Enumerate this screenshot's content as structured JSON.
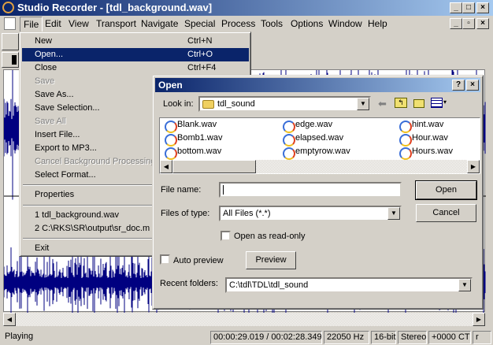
{
  "app": {
    "title": "Studio Recorder - [tdl_background.wav]"
  },
  "menubar": [
    "File",
    "Edit",
    "View",
    "Transport",
    "Navigate",
    "Special",
    "Process",
    "Tools",
    "Options",
    "Window",
    "Help"
  ],
  "file_menu": {
    "items": [
      {
        "label": "New",
        "shortcut": "Ctrl+N",
        "state": "normal"
      },
      {
        "label": "Open...",
        "shortcut": "Ctrl+O",
        "state": "highlighted"
      },
      {
        "label": "Close",
        "shortcut": "Ctrl+F4",
        "state": "normal"
      },
      {
        "label": "Save",
        "shortcut": "",
        "state": "disabled"
      },
      {
        "label": "Save As...",
        "shortcut": "",
        "state": "normal"
      },
      {
        "label": "Save Selection...",
        "shortcut": "",
        "state": "normal"
      },
      {
        "label": "Save All",
        "shortcut": "",
        "state": "disabled"
      },
      {
        "label": "Insert File...",
        "shortcut": "",
        "state": "normal"
      },
      {
        "label": "Export to MP3...",
        "shortcut": "",
        "state": "normal"
      },
      {
        "label": "Cancel Background Processing",
        "shortcut": "",
        "state": "disabled"
      },
      {
        "label": "Select Format...",
        "shortcut": "",
        "state": "normal"
      },
      {
        "label": "Properties",
        "shortcut": "",
        "state": "normal"
      },
      {
        "label": "1 tdl_background.wav",
        "shortcut": "",
        "state": "normal"
      },
      {
        "label": "2 C:\\RKS\\SR\\output\\sr_doc.m",
        "shortcut": "",
        "state": "normal"
      },
      {
        "label": "Exit",
        "shortcut": "",
        "state": "normal"
      }
    ]
  },
  "dialog": {
    "title": "Open",
    "look_in_label": "Look in:",
    "look_in_value": "tdl_sound",
    "files": [
      [
        "Blank.wav",
        "Bomb1.wav",
        "bottom.wav"
      ],
      [
        "edge.wav",
        "elapsed.wav",
        "emptyrow.wav"
      ],
      [
        "hint.wav",
        "Hour.wav",
        "Hours.wav"
      ]
    ],
    "file_name_label": "File name:",
    "file_name_value": "",
    "files_of_type_label": "Files of type:",
    "files_of_type_value": "All Files (*.*)",
    "read_only_label": "Open as read-only",
    "auto_preview_label": "Auto preview",
    "preview_button": "Preview",
    "open_button": "Open",
    "cancel_button": "Cancel",
    "recent_label": "Recent folders:",
    "recent_value": "C:\\tdl\\TDL\\tdl_sound"
  },
  "status": {
    "state": "Playing",
    "time": "00:00:29.019 / 00:02:28.349",
    "rate": "22050 Hz",
    "bits": "16-bit",
    "channels": "Stereo",
    "offset": "+0000 CT",
    "extra": "r"
  }
}
